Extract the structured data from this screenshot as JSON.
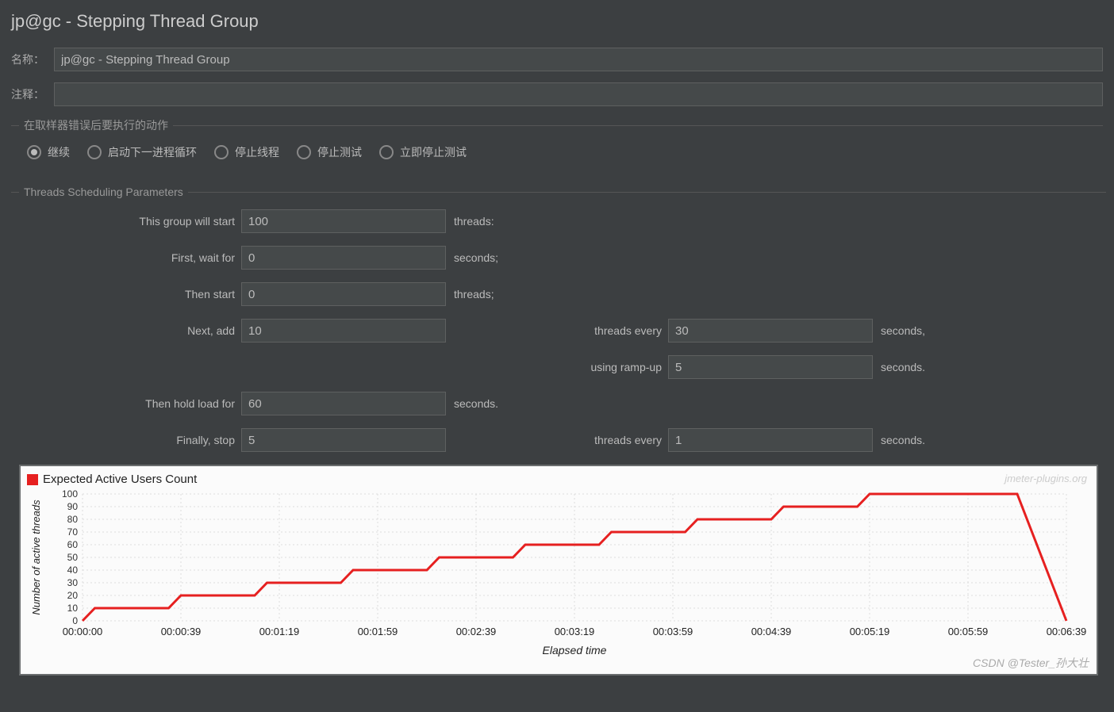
{
  "title": "jp@gc - Stepping Thread Group",
  "fields": {
    "name_label": "名称：",
    "name_value": "jp@gc - Stepping Thread Group",
    "comment_label": "注释：",
    "comment_value": ""
  },
  "error_action": {
    "legend": "在取样器错误后要执行的动作",
    "options": {
      "continue": "继续",
      "next_loop": "启动下一进程循环",
      "stop_thread": "停止线程",
      "stop_test": "停止测试",
      "stop_now": "立即停止测试"
    },
    "selected": "continue"
  },
  "scheduling": {
    "legend": "Threads Scheduling Parameters",
    "labels": {
      "group_start": "This group will start",
      "threads_colon": "threads:",
      "first_wait": "First, wait for",
      "seconds_semi": "seconds;",
      "then_start": "Then start",
      "threads_semi": "threads;",
      "next_add": "Next, add",
      "threads_every": "threads every",
      "seconds_comma": "seconds,",
      "using_rampup": "using ramp-up",
      "seconds_period": "seconds.",
      "hold_load": "Then hold load for",
      "finally_stop": "Finally, stop"
    },
    "values": {
      "group_start": "100",
      "first_wait": "0",
      "then_start": "0",
      "next_add": "10",
      "add_every": "30",
      "rampup": "5",
      "hold": "60",
      "stop": "5",
      "stop_every": "1"
    }
  },
  "chart_data": {
    "type": "line",
    "title": "Expected Active Users Count",
    "xlabel": "Elapsed time",
    "ylabel": "Number of active threads",
    "ylim": [
      0,
      100
    ],
    "y_ticks": [
      0,
      10,
      20,
      30,
      40,
      50,
      60,
      70,
      80,
      90,
      100
    ],
    "x_ticks": [
      "00:00:00",
      "00:00:39",
      "00:01:19",
      "00:01:59",
      "00:02:39",
      "00:03:19",
      "00:03:59",
      "00:04:39",
      "00:05:19",
      "00:05:59",
      "00:06:39"
    ],
    "series": [
      {
        "name": "Expected Active Users Count",
        "color": "#e62020",
        "points": [
          {
            "t": 0,
            "y": 0
          },
          {
            "t": 5,
            "y": 10
          },
          {
            "t": 35,
            "y": 10
          },
          {
            "t": 40,
            "y": 20
          },
          {
            "t": 70,
            "y": 20
          },
          {
            "t": 75,
            "y": 30
          },
          {
            "t": 105,
            "y": 30
          },
          {
            "t": 110,
            "y": 40
          },
          {
            "t": 140,
            "y": 40
          },
          {
            "t": 145,
            "y": 50
          },
          {
            "t": 175,
            "y": 50
          },
          {
            "t": 180,
            "y": 60
          },
          {
            "t": 210,
            "y": 60
          },
          {
            "t": 215,
            "y": 70
          },
          {
            "t": 245,
            "y": 70
          },
          {
            "t": 250,
            "y": 80
          },
          {
            "t": 280,
            "y": 80
          },
          {
            "t": 285,
            "y": 90
          },
          {
            "t": 315,
            "y": 90
          },
          {
            "t": 320,
            "y": 100
          },
          {
            "t": 380,
            "y": 100
          },
          {
            "t": 400,
            "y": 0
          }
        ]
      }
    ],
    "watermark_tr": "jmeter-plugins.org",
    "watermark_br": "CSDN @Tester_孙大壮"
  }
}
